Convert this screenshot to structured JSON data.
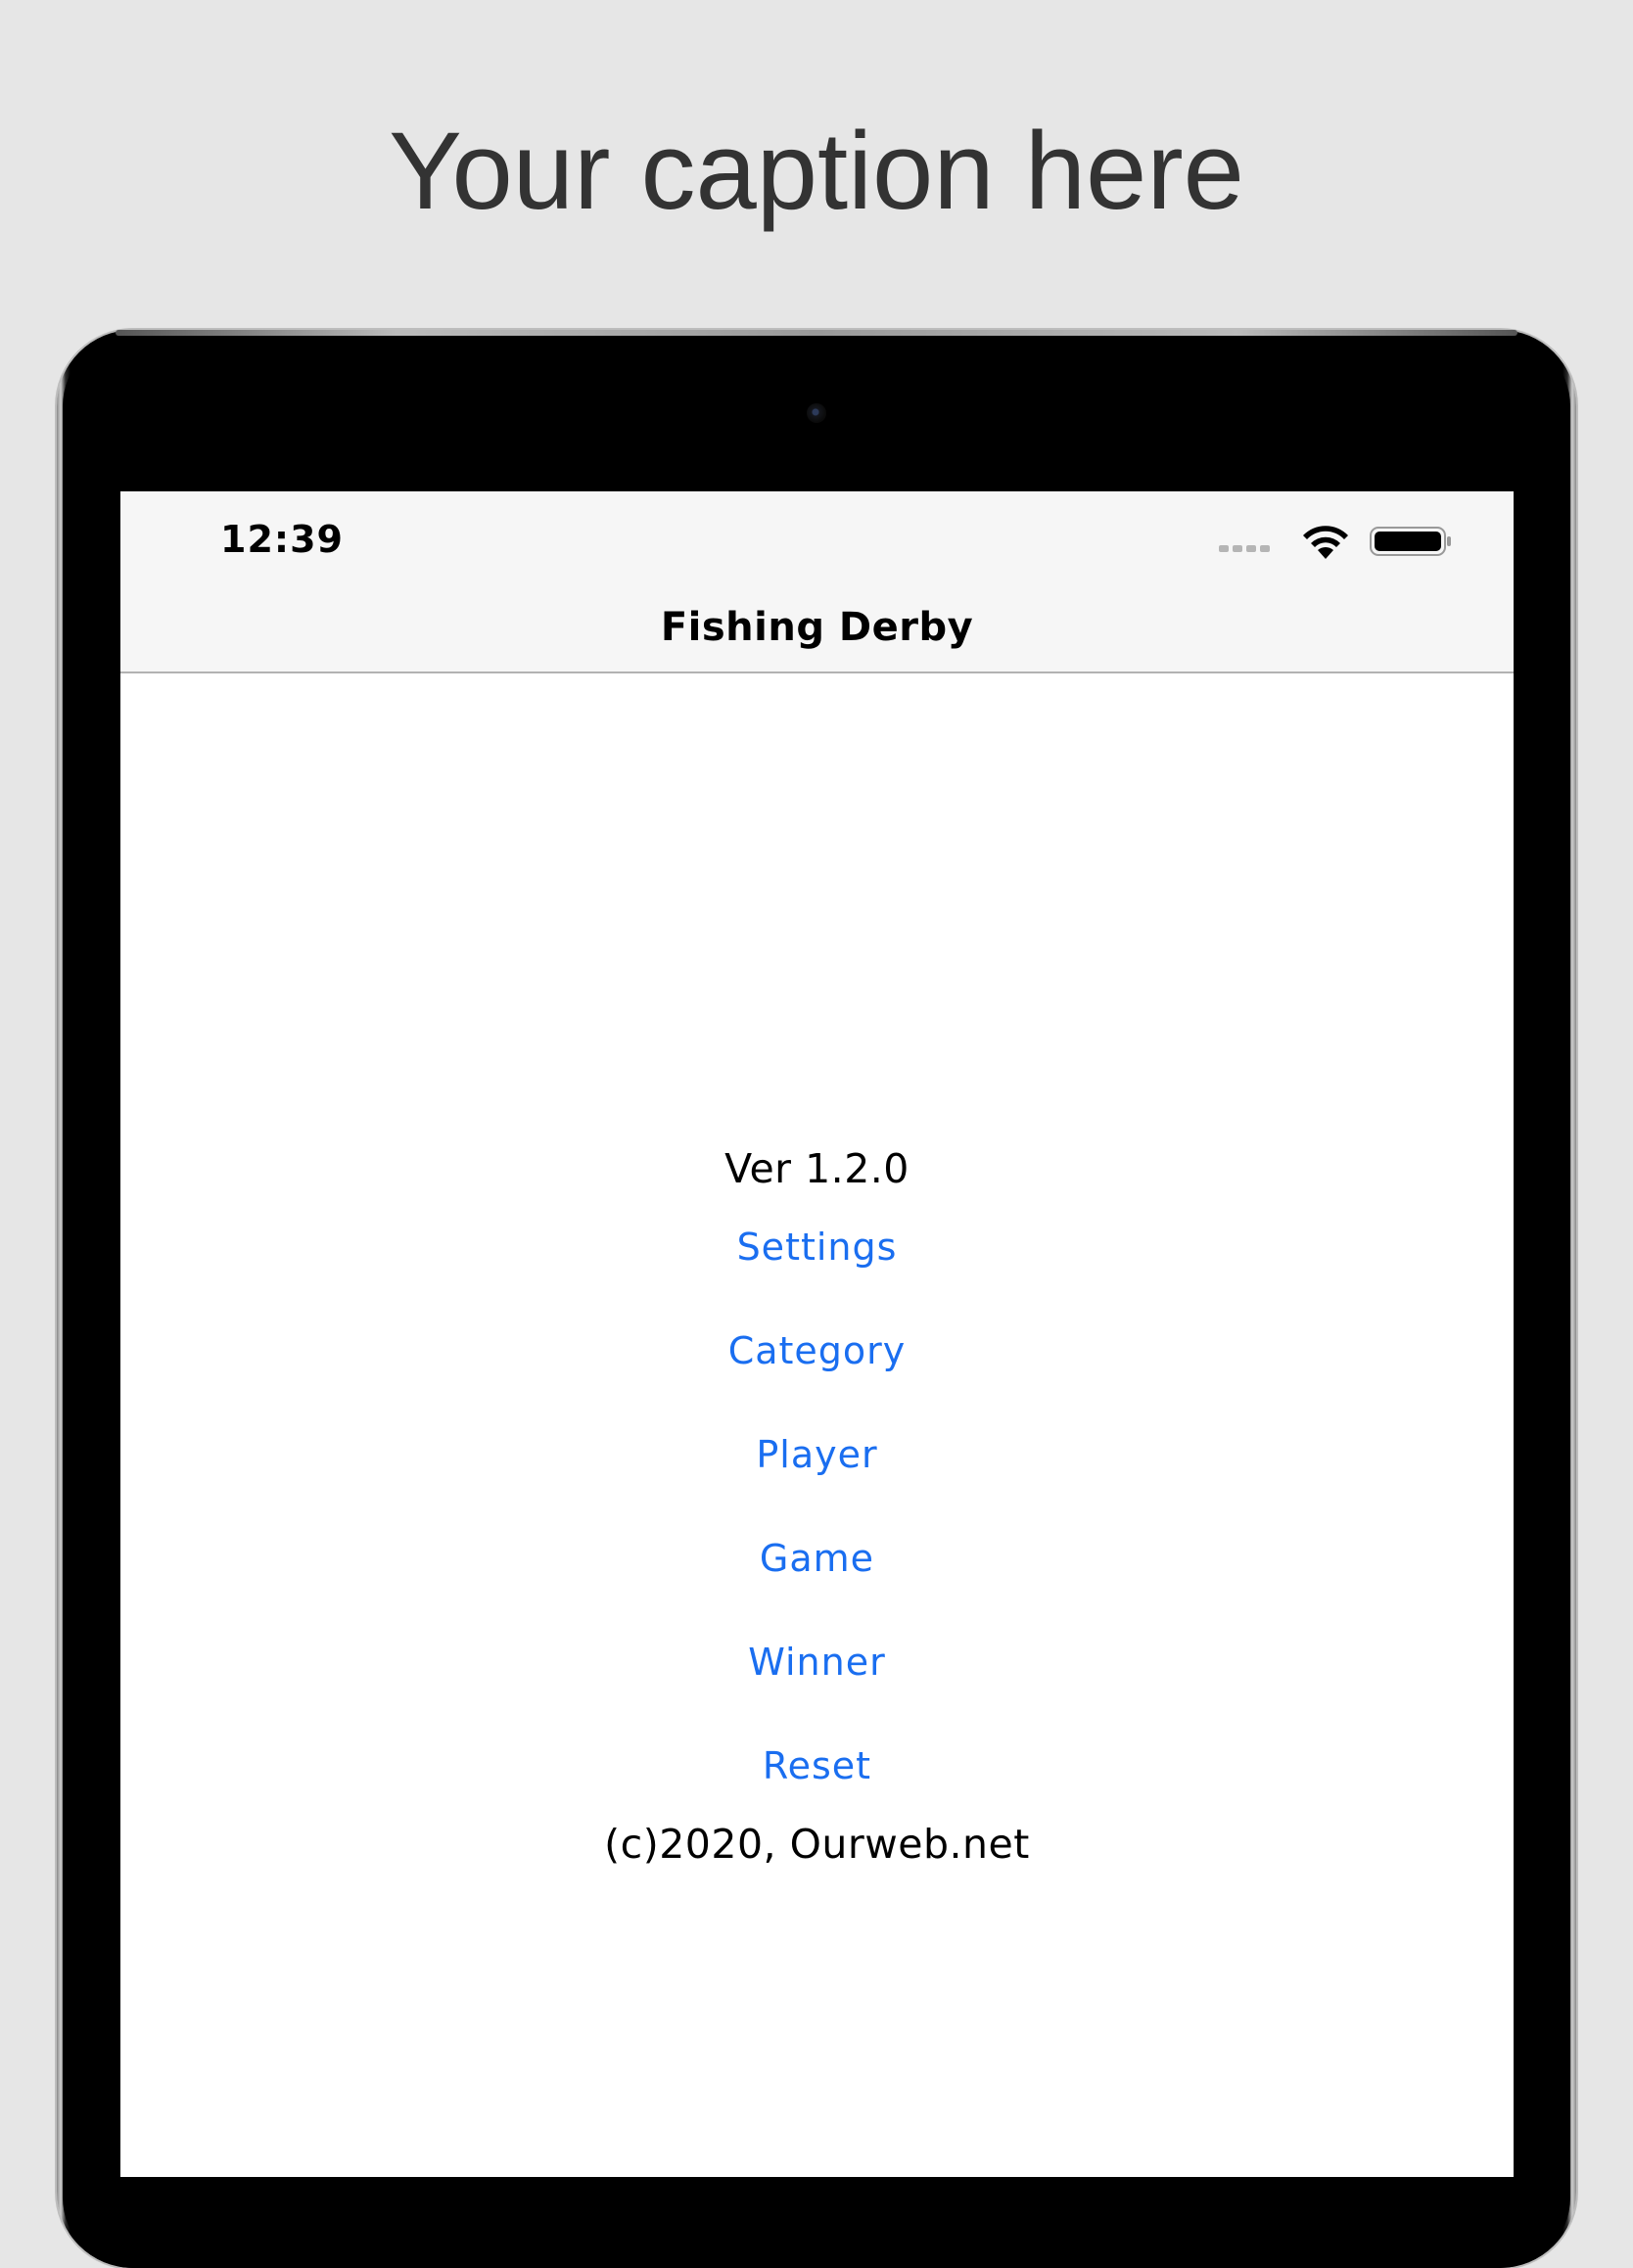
{
  "caption": "Your caption here",
  "status_bar": {
    "time": "12:39",
    "icons": [
      "cellular-signal-icon",
      "wifi-icon",
      "battery-icon"
    ]
  },
  "nav": {
    "title": "Fishing Derby"
  },
  "main": {
    "version": "Ver 1.2.0",
    "menu": [
      {
        "label": "Settings"
      },
      {
        "label": "Category"
      },
      {
        "label": "Player"
      },
      {
        "label": "Game"
      },
      {
        "label": "Winner"
      },
      {
        "label": "Reset"
      }
    ],
    "copyright": "(c)2020, Ourweb.net"
  },
  "colors": {
    "background": "#e6e6e6",
    "caption_text": "#333333",
    "link": "#1a6ef0",
    "bar_background": "#f6f6f6",
    "screen_background": "#ffffff"
  }
}
